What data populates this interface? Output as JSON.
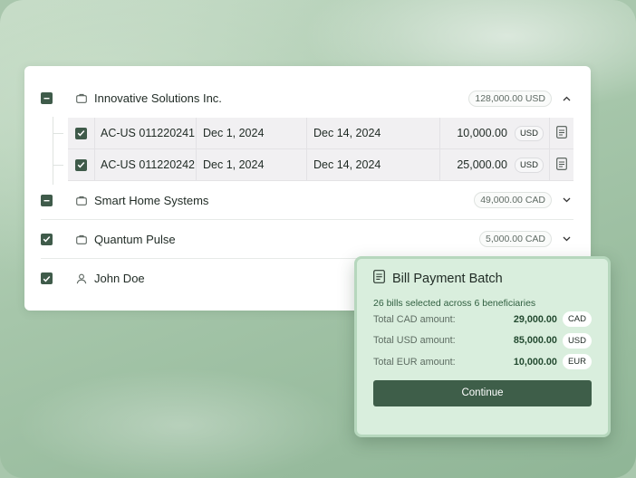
{
  "groups": [
    {
      "name": "Innovative Solutions Inc.",
      "amount": "128,000.00 USD",
      "state": "partial",
      "icon": "briefcase-icon",
      "expanded": true
    },
    {
      "name": "Smart Home Systems",
      "amount": "49,000.00 CAD",
      "state": "partial",
      "icon": "briefcase-icon",
      "expanded": false
    },
    {
      "name": "Quantum Pulse",
      "amount": "5,000.00 CAD",
      "state": "checked",
      "icon": "briefcase-icon",
      "expanded": false
    },
    {
      "name": "John Doe",
      "state": "checked",
      "icon": "user-icon"
    }
  ],
  "bills": [
    {
      "account": "AC-US 011220241",
      "date1": "Dec 1, 2024",
      "date2": "Dec 14, 2024",
      "amount": "10,000.00",
      "currency": "USD"
    },
    {
      "account": "AC-US 011220242",
      "date1": "Dec 1, 2024",
      "date2": "Dec 14, 2024",
      "amount": "25,000.00",
      "currency": "USD"
    }
  ],
  "batch": {
    "title": "Bill Payment Batch",
    "subtitle": "26 bills selected across 6 beneficiaries",
    "totals": [
      {
        "label": "Total CAD amount:",
        "value": "29,000.00",
        "currency": "CAD"
      },
      {
        "label": "Total USD amount:",
        "value": "85,000.00",
        "currency": "USD"
      },
      {
        "label": "Total EUR amount:",
        "value": "10,000.00",
        "currency": "EUR"
      }
    ],
    "continue_label": "Continue"
  },
  "colors": {
    "accent": "#3e5e49",
    "batch_bg": "#d9eedd",
    "amount_green": "#234a30"
  }
}
